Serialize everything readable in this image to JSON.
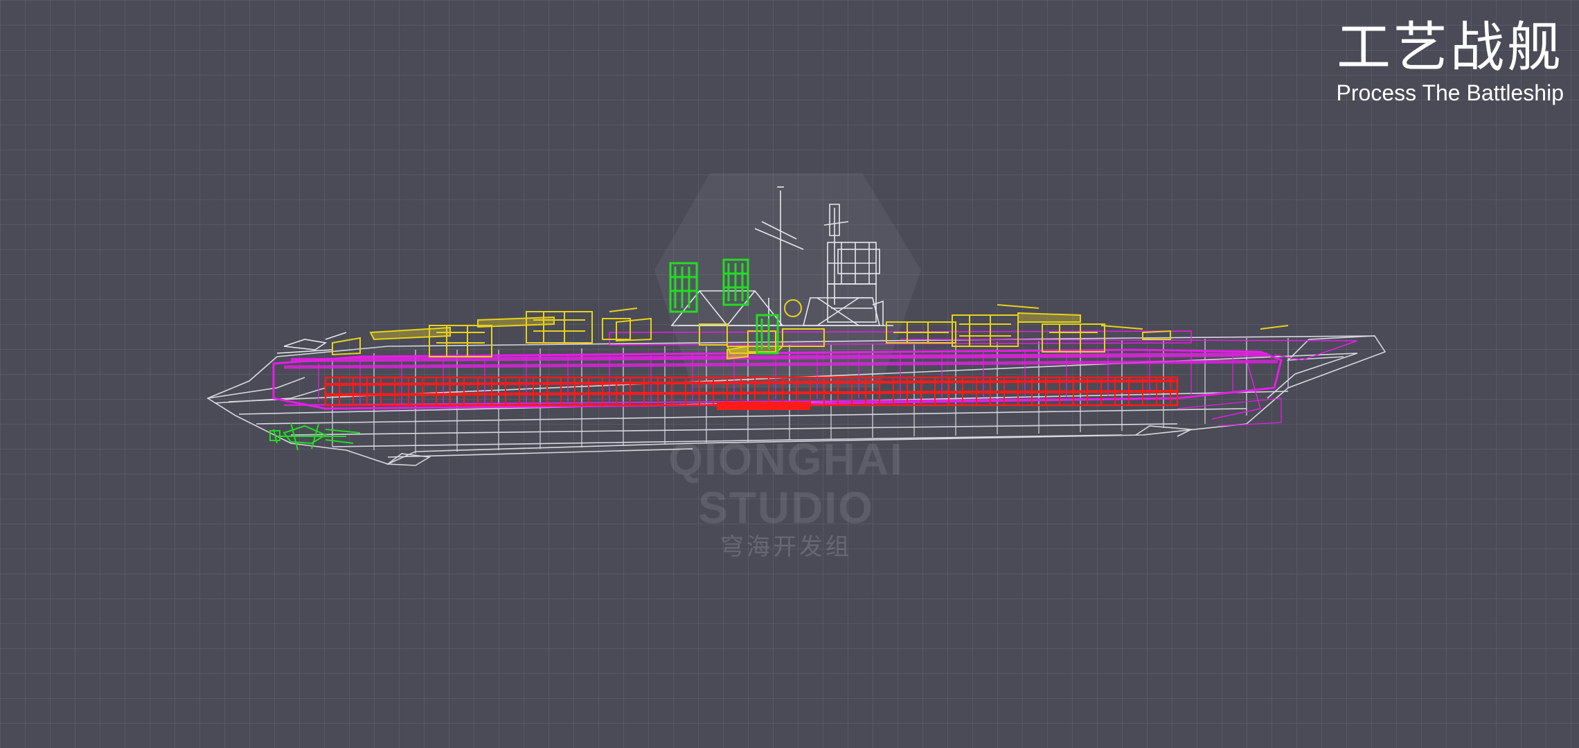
{
  "title": {
    "cn": "工艺战舰",
    "en": "Process The Battleship"
  },
  "watermark": {
    "logo_icon": "shield-logo-icon",
    "en": "QIONGHAI STUDIO",
    "cn": "穹海开发组"
  },
  "colors": {
    "background": "#4a4b57",
    "hull_wire": "#e8e8ee",
    "armor_magenta": "#e61ee6",
    "citadel_red": "#ff1a1a",
    "turret_yellow": "#e8d21a",
    "module_green": "#22dd22"
  }
}
